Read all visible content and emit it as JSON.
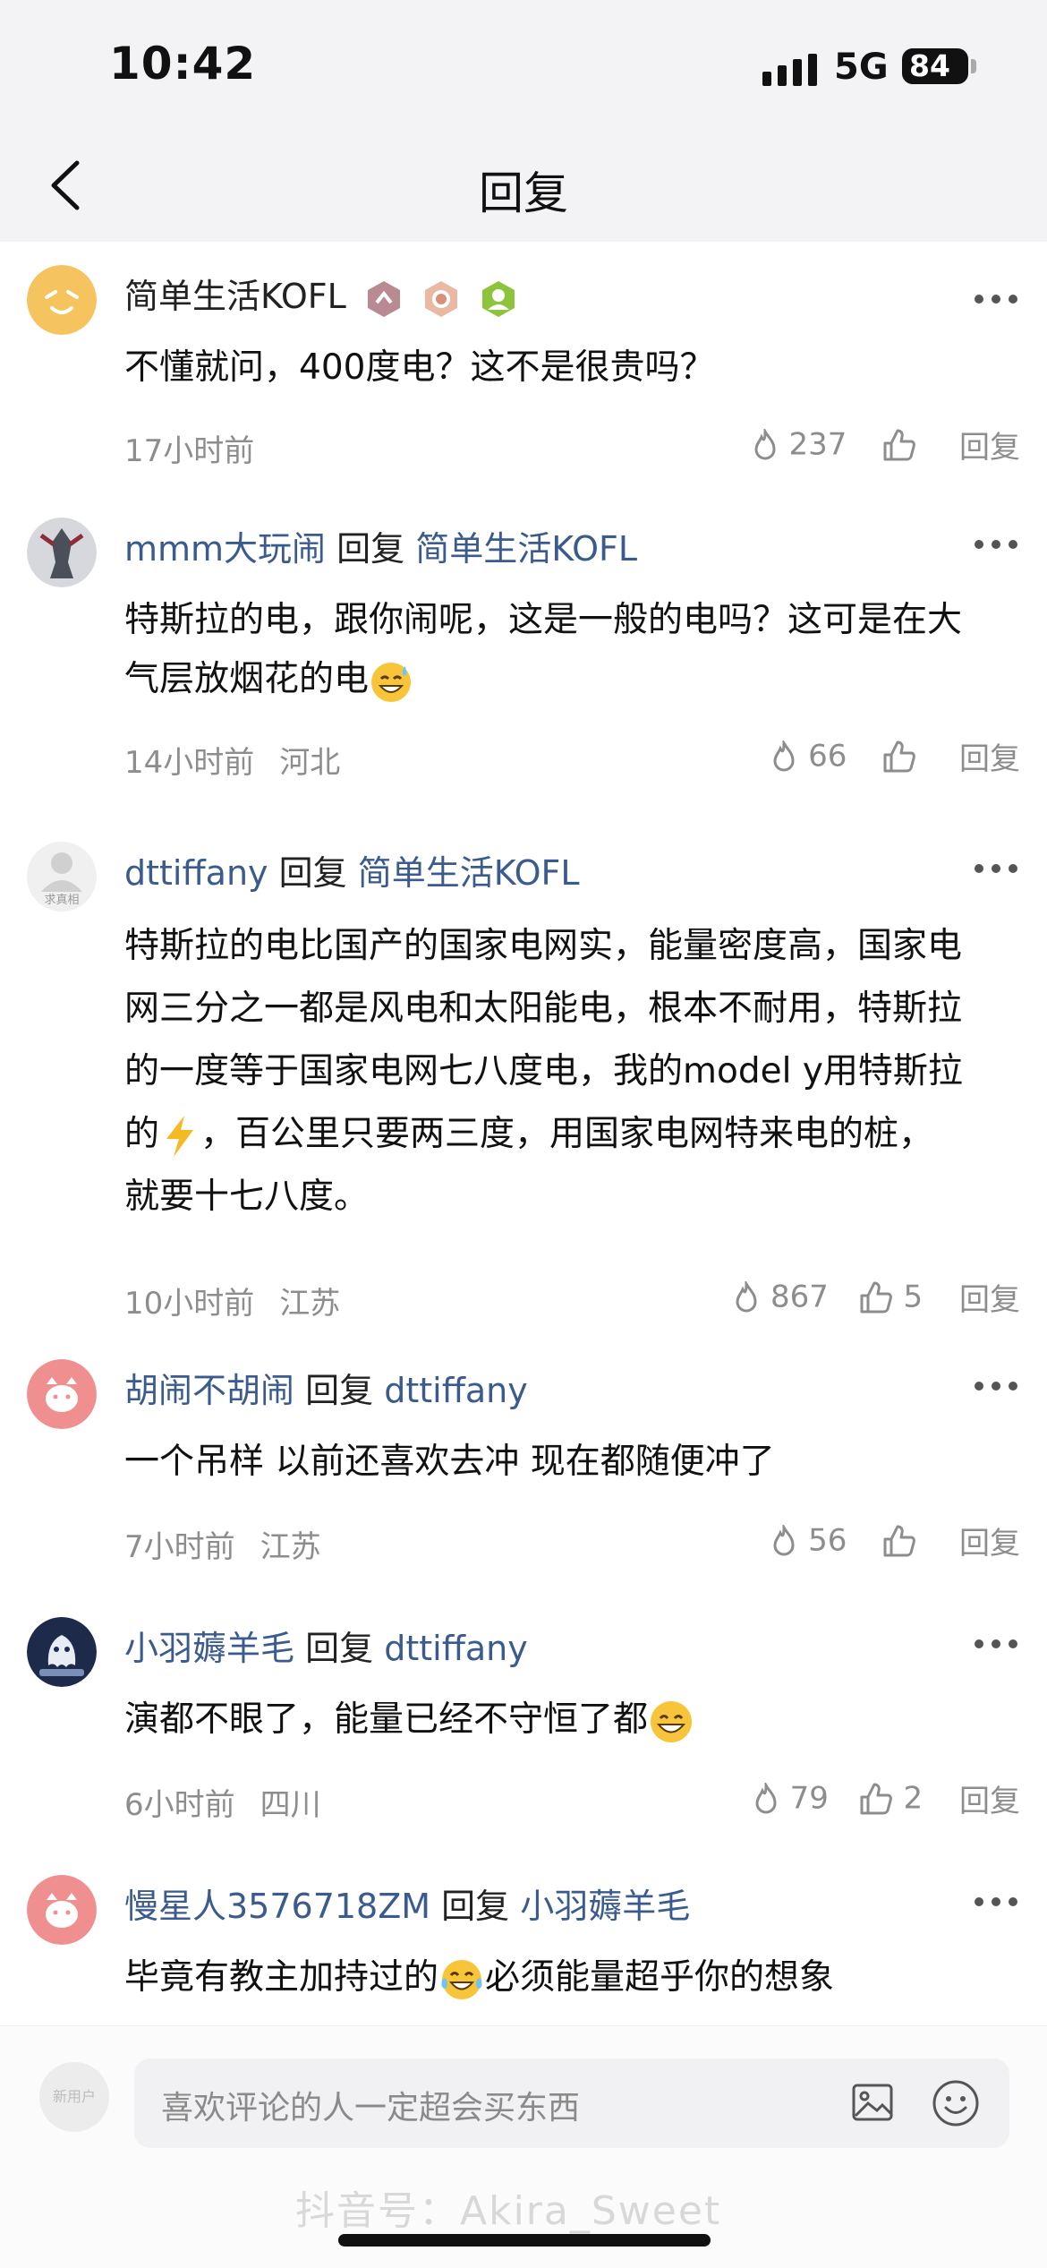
{
  "status_bar": {
    "time": "10:42",
    "network": "5G",
    "battery": "84"
  },
  "nav": {
    "title": "回复",
    "back_icon": "chevron-left-icon"
  },
  "comments": [
    {
      "author": "简单生活KOFL",
      "reply_to": "",
      "text": "不懂就问，400度电？这不是很贵吗？",
      "time": "17小时前",
      "location": "",
      "hot_count": "237",
      "like_count": "",
      "reply_label": "回复"
    },
    {
      "author": "mmm大玩闹",
      "reply_word": "回复",
      "reply_to": "简单生活KOFL",
      "text_line1": "特斯拉的电，跟你闹呢，这是一般的电吗？这可是在大",
      "text_line2": "气层放烟花的电",
      "time": "14小时前",
      "location": "河北",
      "hot_count": "66",
      "like_count": "",
      "reply_label": "回复"
    },
    {
      "author": "dttiffany",
      "reply_word": "回复",
      "reply_to": "简单生活KOFL",
      "avatar_caption": "求真相",
      "text_line1": "特斯拉的电比国产的国家电网实，能量密度高，国家电",
      "text_line2": "网三分之一都是风电和太阳能电，根本不耐用，特斯拉",
      "text_line3": "的一度等于国家电网七八度电，我的model y用特斯拉",
      "text_line4a": "的",
      "text_line4b": "，百公里只要两三度，用国家电网特来电的桩，",
      "text_line5": "就要十七八度。",
      "time": "10小时前",
      "location": "江苏",
      "hot_count": "867",
      "like_count": "5",
      "reply_label": "回复"
    },
    {
      "author": "胡闹不胡闹",
      "reply_word": "回复",
      "reply_to": "dttiffany",
      "text": "一个吊样 以前还喜欢去冲 现在都随便冲了",
      "time": "7小时前",
      "location": "江苏",
      "hot_count": "56",
      "like_count": "",
      "reply_label": "回复"
    },
    {
      "author": "小羽薅羊毛",
      "reply_word": "回复",
      "reply_to": "dttiffany",
      "text": "演都不眼了，能量已经不守恒了都",
      "time": "6小时前",
      "location": "四川",
      "hot_count": "79",
      "like_count": "2",
      "reply_label": "回复"
    },
    {
      "author": "慢星人3576718ZM",
      "reply_word": "回复",
      "reply_to": "小羽薅羊毛",
      "text_a": "毕竟有教主加持过的",
      "text_b": "必须能量超乎你的想象"
    }
  ],
  "bottom_bar": {
    "my_avatar_caption": "新用户",
    "placeholder": "喜欢评论的人一定超会买东西",
    "watermark": "抖音号：Akira_Sweet"
  },
  "colors": {
    "name": "#3b5a8e",
    "meta": "#8d8d8d",
    "header_bg": "#f3f3f5"
  }
}
